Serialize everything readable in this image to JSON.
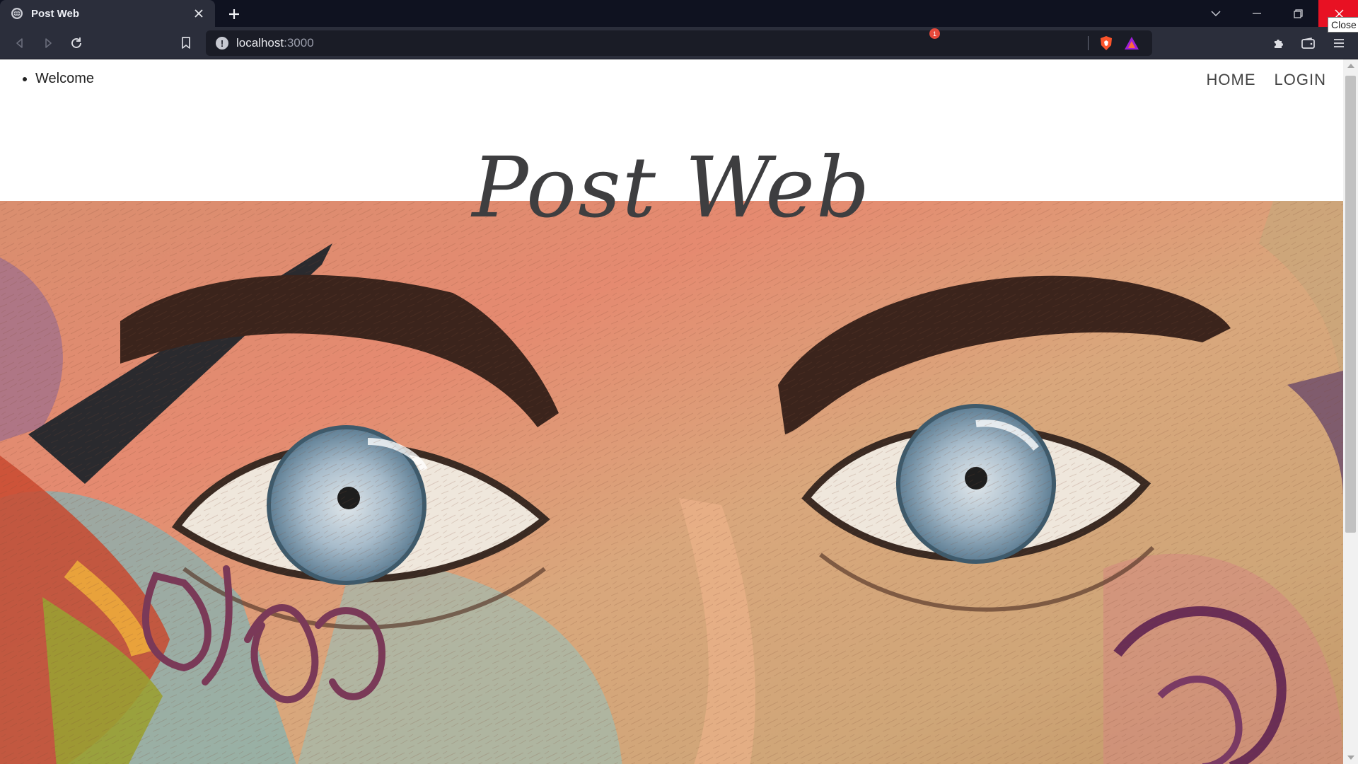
{
  "browser": {
    "tab_title": "Post Web",
    "url_host": "localhost",
    "url_port": ":3000",
    "close_tooltip": "Close",
    "rewards_badge": "1"
  },
  "page": {
    "nav_left": [
      "Welcome"
    ],
    "nav_right": [
      "HOME",
      "LOGIN"
    ],
    "site_title": "Post Web"
  },
  "colors": {
    "chrome_dark": "#0f1220",
    "toolbar": "#2b2e3b",
    "close_red": "#e81123",
    "title_text": "#3e3e40"
  },
  "icons": {
    "back": "back-arrow-icon",
    "forward": "forward-arrow-icon",
    "reload": "reload-icon",
    "bookmark": "bookmark-icon",
    "info": "info-icon",
    "brave": "brave-shield-icon",
    "rewards": "rewards-triangle-icon",
    "extensions": "puzzle-icon",
    "wallet": "wallet-icon",
    "menu": "hamburger-menu-icon"
  }
}
